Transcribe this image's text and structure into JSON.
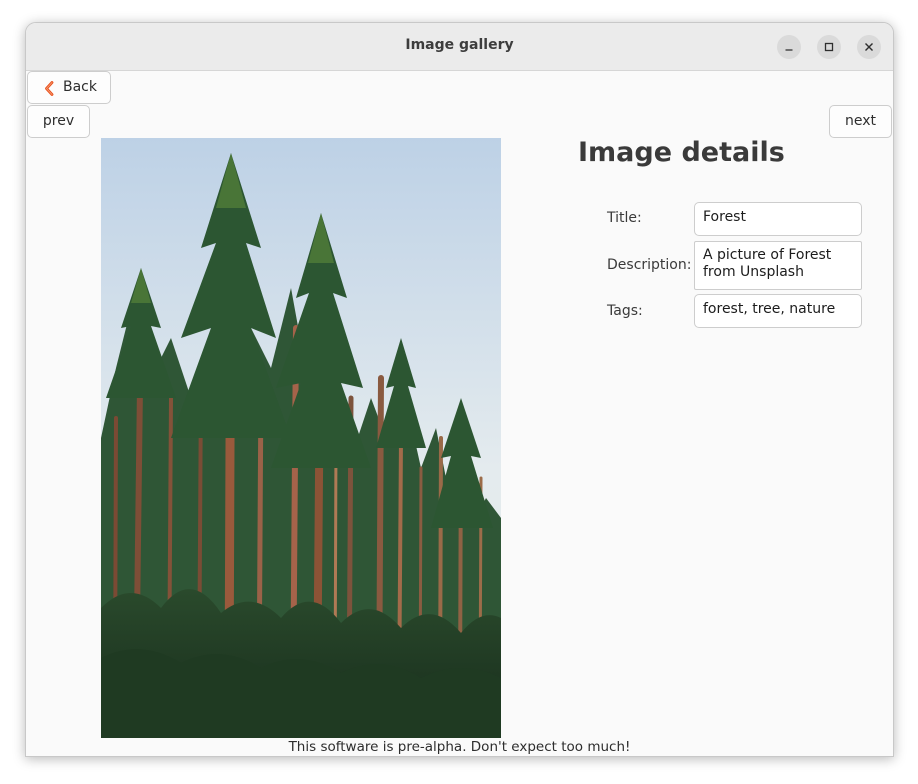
{
  "window": {
    "title": "Image gallery"
  },
  "nav": {
    "back_label": "Back",
    "prev_label": "prev",
    "next_label": "next"
  },
  "details": {
    "heading": "Image details",
    "title_label": "Title:",
    "title_value": "Forest",
    "description_label": "Description:",
    "description_value": "A picture of Forest from Unsplash",
    "tags_label": "Tags:",
    "tags_value": "forest, tree, nature"
  },
  "footer": {
    "text": "This software is pre-alpha. Don't expect too much!"
  },
  "colors": {
    "accent": "#e95420",
    "window_bg": "#fafafa",
    "titlebar_bg": "#ebebeb"
  },
  "icons": {
    "back": "chevron-left-icon",
    "minimize": "minimize-icon",
    "maximize": "maximize-icon",
    "close": "close-icon"
  }
}
